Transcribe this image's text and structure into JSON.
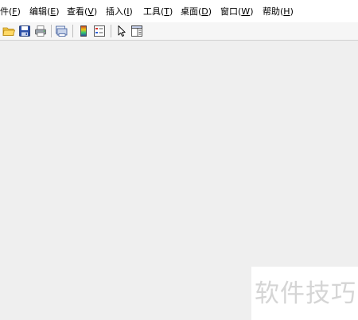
{
  "menubar": {
    "items": [
      {
        "prefix": "件(",
        "key": "F",
        "suffix": ")"
      },
      {
        "prefix": "编辑(",
        "key": "E",
        "suffix": ")"
      },
      {
        "prefix": "查看(",
        "key": "V",
        "suffix": ")"
      },
      {
        "prefix": "插入(",
        "key": "I",
        "suffix": ")"
      },
      {
        "prefix": "工具(",
        "key": "T",
        "suffix": ")"
      },
      {
        "prefix": "桌面(",
        "key": "D",
        "suffix": ")"
      },
      {
        "prefix": "窗口(",
        "key": "W",
        "suffix": ")"
      },
      {
        "prefix": "帮助(",
        "key": "H",
        "suffix": ")"
      }
    ]
  },
  "toolbar": {
    "buttons": [
      "open-folder-icon",
      "save-icon",
      "print-icon",
      "print-preview-icon",
      "colorbar-icon",
      "legend-icon",
      "pointer-icon",
      "property-editor-icon"
    ]
  },
  "watermark": {
    "text": "软件技巧"
  },
  "colors": {
    "menubar_bg": "#ffffff",
    "workspace_bg": "#efefef",
    "watermark_text": "#d5d5d5"
  }
}
